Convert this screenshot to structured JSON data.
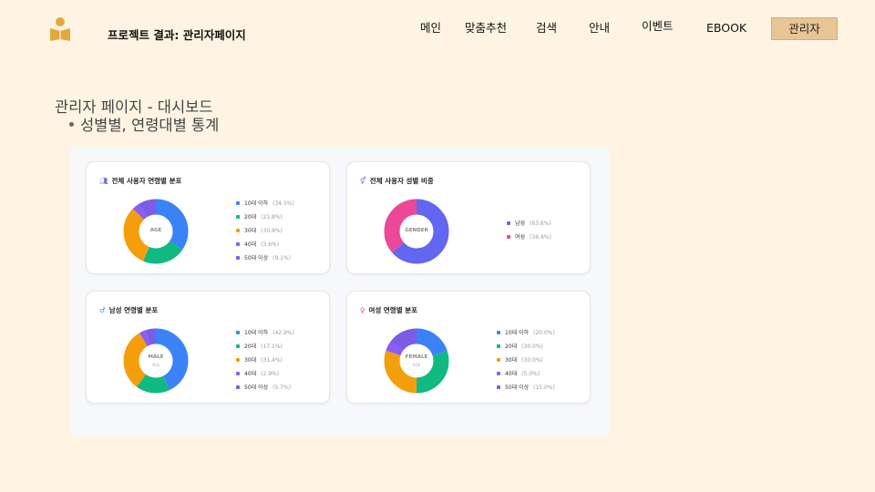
{
  "header": {
    "logo": "book-reader-icon",
    "title": "프로젝트 결과: 관리자페이지",
    "nav": [
      "메인",
      "맞춤추천",
      "검색",
      "안내",
      "이벤트",
      "EBOOK"
    ],
    "active_nav": "관리자"
  },
  "section": {
    "title": "관리자 페이지 - 대시보드",
    "bullet": "성별별, 연령대별 통계"
  },
  "colors": {
    "blue": "#3b82f6",
    "green": "#10b981",
    "orange": "#f59e0b",
    "purple": "#8b5cf6",
    "indigo": "#6366f1",
    "pink": "#ec4899",
    "accent": "#e8c595"
  },
  "cards": [
    {
      "icon": "users-icon",
      "title": "전체 사용자 연령별 분포",
      "center_label": "AGE",
      "center_sub": "",
      "segments": [
        {
          "label": "10대 이하",
          "pct": "(34.5%)",
          "value": 34.5,
          "color": "#3b82f6"
        },
        {
          "label": "20대",
          "pct": "(21.8%)",
          "value": 21.8,
          "color": "#10b981"
        },
        {
          "label": "30대",
          "pct": "(30.9%)",
          "value": 30.9,
          "color": "#f59e0b"
        },
        {
          "label": "40대",
          "pct": "(3.6%)",
          "value": 3.6,
          "color": "#8b5cf6"
        },
        {
          "label": "50대 이상",
          "pct": "(9.1%)",
          "value": 9.1,
          "color": "#7c5ce6"
        }
      ]
    },
    {
      "icon": "gender-icon",
      "title": "전체 사용자 성별 비중",
      "center_label": "GENDER",
      "center_sub": "",
      "segments": [
        {
          "label": "남성",
          "pct": "(63.6%)",
          "value": 63.6,
          "color": "#6366f1"
        },
        {
          "label": "여성",
          "pct": "(36.4%)",
          "value": 36.4,
          "color": "#ec4899"
        }
      ]
    },
    {
      "icon": "male-icon",
      "title": "남성 연령별 분포",
      "center_label": "MALE",
      "center_sub": "AGE",
      "segments": [
        {
          "label": "10대 이하",
          "pct": "(42.9%)",
          "value": 42.9,
          "color": "#3b82f6"
        },
        {
          "label": "20대",
          "pct": "(17.1%)",
          "value": 17.1,
          "color": "#10b981"
        },
        {
          "label": "30대",
          "pct": "(31.4%)",
          "value": 31.4,
          "color": "#f59e0b"
        },
        {
          "label": "40대",
          "pct": "(2.9%)",
          "value": 2.9,
          "color": "#8b5cf6"
        },
        {
          "label": "50대 이상",
          "pct": "(5.7%)",
          "value": 5.7,
          "color": "#7c5ce6"
        }
      ]
    },
    {
      "icon": "female-icon",
      "title": "여성 연령별 분포",
      "center_label": "FEMALE",
      "center_sub": "AGE",
      "segments": [
        {
          "label": "10대 이하",
          "pct": "(20.0%)",
          "value": 20.0,
          "color": "#3b82f6"
        },
        {
          "label": "20대",
          "pct": "(30.0%)",
          "value": 30.0,
          "color": "#10b981"
        },
        {
          "label": "30대",
          "pct": "(30.0%)",
          "value": 30.0,
          "color": "#f59e0b"
        },
        {
          "label": "40대",
          "pct": "(5.0%)",
          "value": 5.0,
          "color": "#8b5cf6"
        },
        {
          "label": "50대 이상",
          "pct": "(15.0%)",
          "value": 15.0,
          "color": "#7c5ce6"
        }
      ]
    }
  ]
}
